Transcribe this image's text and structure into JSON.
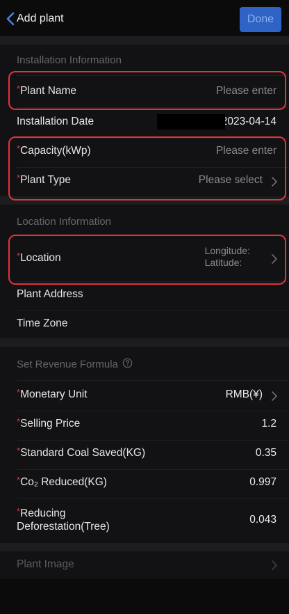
{
  "header": {
    "back_label": "Add plant",
    "done_label": "Done"
  },
  "installation": {
    "title": "Installation Information",
    "plant_name": {
      "label": "Plant Name",
      "placeholder": "Please enter"
    },
    "installation_date": {
      "label": "Installation Date",
      "value": "2023-04-14"
    },
    "capacity": {
      "label": "Capacity(kWp)",
      "placeholder": "Please enter"
    },
    "plant_type": {
      "label": "Plant Type",
      "placeholder": "Please select"
    }
  },
  "location_info": {
    "title": "Location Information",
    "location": {
      "label": "Location",
      "longitude": "Longitude:",
      "latitude": "Latitude:"
    },
    "plant_address": {
      "label": "Plant Address"
    },
    "time_zone": {
      "label": "Time Zone"
    }
  },
  "revenue": {
    "title": "Set Revenue Formula",
    "monetary_unit": {
      "label": "Monetary Unit",
      "value": "RMB(¥)"
    },
    "selling_price": {
      "label": "Selling Price",
      "value": "1.2"
    },
    "coal_saved": {
      "label": "Standard Coal Saved(KG)",
      "value": "0.35"
    },
    "co2_reduced": {
      "label": "Co₂ Reduced(KG)",
      "value": "0.997"
    },
    "deforestation": {
      "label_line1": "Reducing",
      "label_line2": "Deforestation(Tree)",
      "value": "0.043"
    }
  },
  "plant_image": {
    "label": "Plant Image"
  },
  "required_marker": "*",
  "colors": {
    "accent": "#2f64c6",
    "required": "#e0383c",
    "highlight": "#e5323a",
    "background": "#0b0b0c",
    "section": "#121214"
  },
  "icons": [
    "chevron-left-icon",
    "chevron-right-icon",
    "question-circle-icon"
  ]
}
